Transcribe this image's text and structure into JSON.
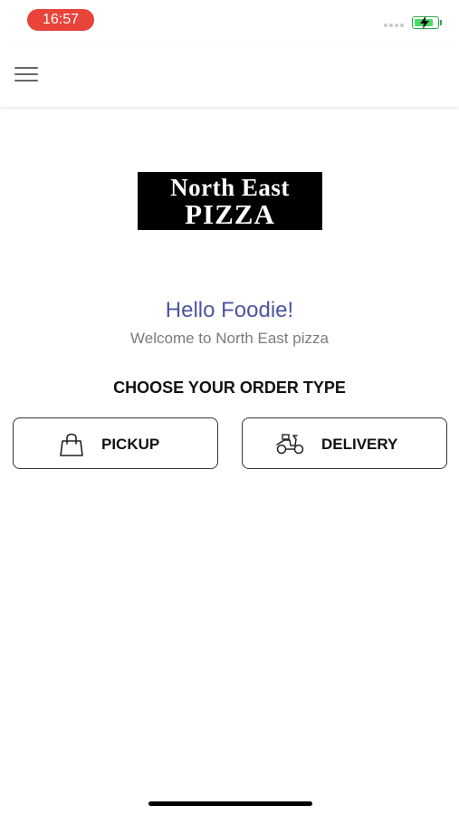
{
  "status_bar": {
    "time": "16:57",
    "battery_level": 0.85,
    "battery_color": "#4cd964",
    "time_pill_color": "#e8443a"
  },
  "header": {
    "menu_icon": "hamburger-menu-icon"
  },
  "logo": {
    "line1": "North East",
    "line2": "PIZZA"
  },
  "greeting": "Hello Foodie!",
  "welcome": "Welcome to North East pizza",
  "order_type": {
    "heading": "CHOOSE YOUR ORDER TYPE",
    "options": [
      {
        "label": "PICKUP",
        "icon": "shopping-bag-icon"
      },
      {
        "label": "DELIVERY",
        "icon": "scooter-icon"
      }
    ]
  },
  "colors": {
    "greeting": "#4d55a0",
    "welcome": "#7b7b7b"
  }
}
